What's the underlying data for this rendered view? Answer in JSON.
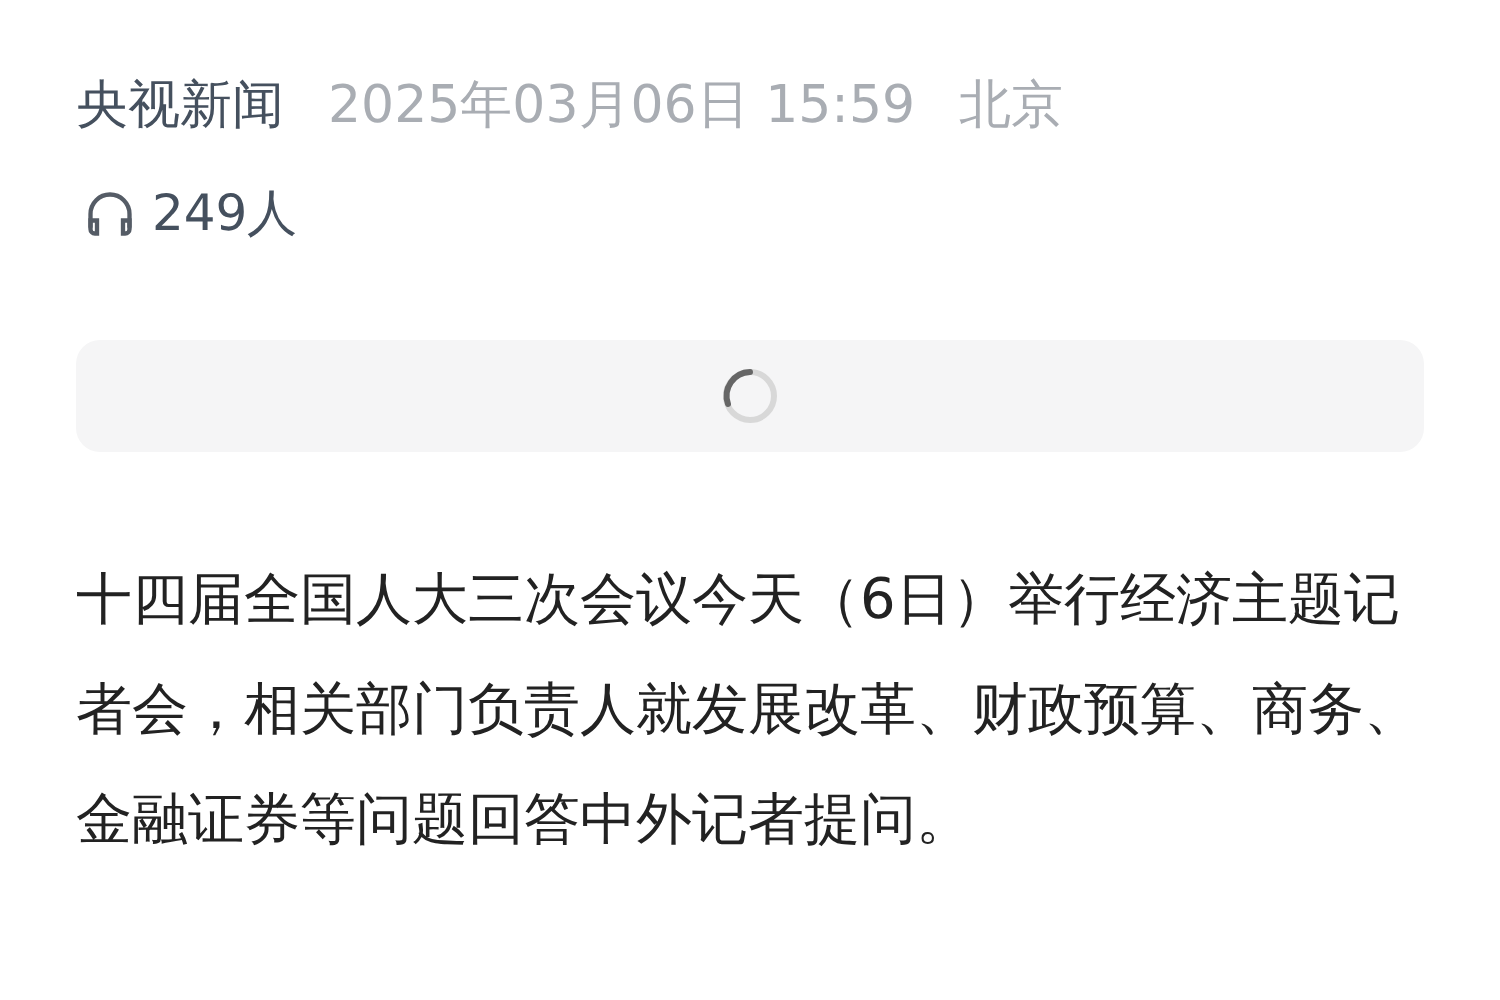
{
  "article": {
    "source": "央视新闻",
    "published": "2025年03月06日 15:59",
    "location": "北京",
    "listeners": "249人",
    "media": {
      "loading": true
    },
    "body": "十四届全国人大三次会议今天（6日）举行经济主题记者会，相关部门负责人就发展改革、财政预算、商务、金融证券等问题回答中外记者提问。"
  }
}
